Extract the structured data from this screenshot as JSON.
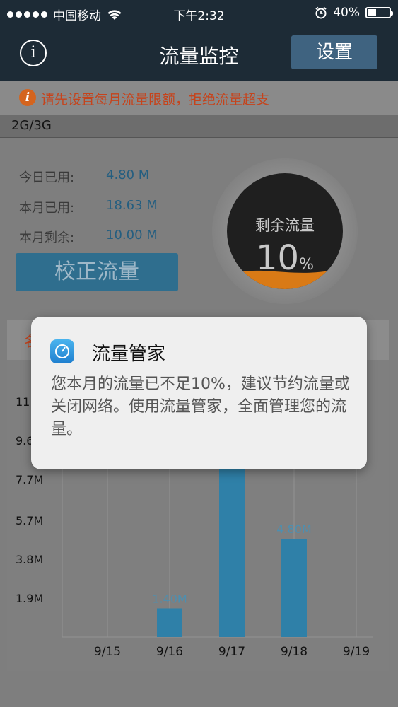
{
  "status_bar": {
    "carrier": "中国移动",
    "time": "下午2:32",
    "battery_percent": "40%",
    "battery_level": 0.4
  },
  "navbar": {
    "info_glyph": "i",
    "title": "流量监控",
    "settings_label": "设置"
  },
  "warning": {
    "icon_glyph": "i",
    "text": "请先设置每月流量限额，拒绝流量超支"
  },
  "section": {
    "network": "2G/3G"
  },
  "stats": [
    {
      "label": "今日已用:",
      "value": "4.80 M"
    },
    {
      "label": "本月已用:",
      "value": "18.63 M"
    },
    {
      "label": "本月剩余:",
      "value": "10.00 M"
    }
  ],
  "calibrate_label": "校正流量",
  "gauge": {
    "label": "剩余流量",
    "value": "10",
    "unit": "%",
    "fraction": 0.1
  },
  "banner_partial": "名",
  "chart_data": {
    "type": "bar",
    "categories": [
      "9/15",
      "9/16",
      "9/17",
      "9/18",
      "9/19"
    ],
    "values": [
      0,
      1.4,
      12.43,
      4.8,
      0
    ],
    "data_labels": [
      "",
      "1.40M",
      "",
      "4.80M",
      ""
    ],
    "y_ticks": [
      "1.9M",
      "3.8M",
      "5.7M",
      "7.7M",
      "9.6M",
      "11.5M"
    ],
    "y_tick_values": [
      1.9,
      3.8,
      5.7,
      7.7,
      9.6,
      11.5
    ],
    "ylim": [
      0,
      12.5
    ],
    "grid": true,
    "bar_color": "#2f80a8"
  },
  "notification": {
    "app_name": "流量管家",
    "message": "您本月的流量已不足10%，建议节约流量或关闭网络。使用流量管家，全面管理您的流量。"
  }
}
